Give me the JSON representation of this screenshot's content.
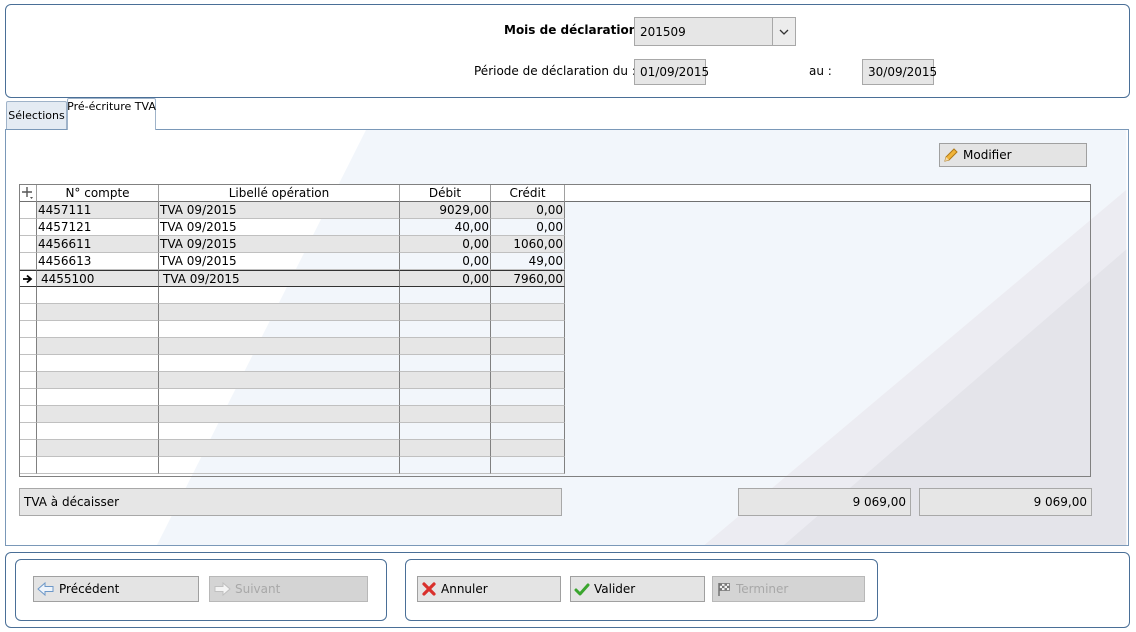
{
  "header": {
    "mois_label": "Mois de déclaration :",
    "mois_value": "201509",
    "periode_label": "Période de déclaration du :",
    "date_from": "01/09/2015",
    "au_label": "au :",
    "date_to": "30/09/2015"
  },
  "tabs": [
    {
      "label": "Sélections",
      "active": false
    },
    {
      "label": "Pré-écriture TVA",
      "active": true
    }
  ],
  "toolbar": {
    "modifier_label": "Modifier"
  },
  "grid": {
    "columns": [
      "N° compte",
      "Libellé opération",
      "Débit",
      "Crédit"
    ],
    "rows": [
      {
        "compte": "4457111",
        "libelle": "TVA 09/2015",
        "debit": "9029,00",
        "credit": "0,00"
      },
      {
        "compte": "4457121",
        "libelle": "TVA 09/2015",
        "debit": "40,00",
        "credit": "0,00"
      },
      {
        "compte": "4456611",
        "libelle": "TVA 09/2015",
        "debit": "0,00",
        "credit": "1060,00"
      },
      {
        "compte": "4456613",
        "libelle": "TVA 09/2015",
        "debit": "0,00",
        "credit": "49,00"
      },
      {
        "compte": "4455100",
        "libelle": "TVA 09/2015",
        "debit": "0,00",
        "credit": "7960,00"
      }
    ],
    "selected_row": 4
  },
  "totals": {
    "label": "TVA à décaisser",
    "debit_total": "9 069,00",
    "credit_total": "9 069,00"
  },
  "nav": {
    "precedent": "Précédent",
    "suivant": "Suivant",
    "annuler": "Annuler",
    "valider": "Valider",
    "terminer": "Terminer"
  },
  "colors": {
    "panel_border": "#4a6f97",
    "field_bg": "#e6e6e6",
    "cancel_red": "#d9302c",
    "valid_green": "#3aa52e"
  },
  "icons": [
    "add-column-icon",
    "pencil-icon",
    "row-pointer-arrow-icon",
    "chevron-down-icon",
    "back-arrow-icon",
    "forward-arrow-icon",
    "cancel-x-icon",
    "check-icon",
    "finish-flag-icon"
  ]
}
